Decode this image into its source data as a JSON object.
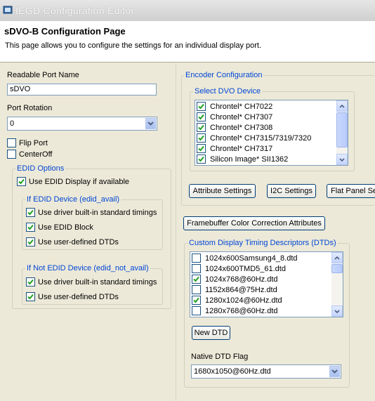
{
  "window": {
    "title": "IEGD Configuration Editor"
  },
  "header": {
    "title": "sDVO-B Configuration Page",
    "description": "This page allows you to configure the settings for an individual display port."
  },
  "left": {
    "port_name_label": "Readable Port Name",
    "port_name_value": "sDVO",
    "rotation_label": "Port Rotation",
    "rotation_value": "0",
    "flip_port": {
      "label": "Flip Port",
      "checked": false
    },
    "center_off": {
      "label": "CenterOff",
      "checked": false
    },
    "edid_options": {
      "title": "EDID Options",
      "use_edid": {
        "label": "Use EDID Display if available",
        "checked": true
      },
      "if_edid": {
        "title": "If EDID Device (edid_avail)",
        "items": [
          {
            "label": "Use driver built-in standard timings",
            "checked": true
          },
          {
            "label": "Use EDID Block",
            "checked": true
          },
          {
            "label": "Use user-defined DTDs",
            "checked": true
          }
        ]
      },
      "if_not_edid": {
        "title": "If Not EDID Device (edid_not_avail)",
        "items": [
          {
            "label": "Use driver built-in standard timings",
            "checked": true
          },
          {
            "label": "Use user-defined DTDs",
            "checked": true
          }
        ]
      }
    }
  },
  "right": {
    "encoder": {
      "title": "Encoder Configuration",
      "select_title": "Select DVO Device",
      "devices": [
        {
          "label": "Chrontel* CH7022",
          "checked": true
        },
        {
          "label": "Chrontel* CH7307",
          "checked": true
        },
        {
          "label": "Chrontel* CH7308",
          "checked": true
        },
        {
          "label": "Chrontel* CH7315/7319/7320",
          "checked": true
        },
        {
          "label": "Chrontel* CH7317",
          "checked": true
        },
        {
          "label": "Silicon Image* SII1362",
          "checked": true
        }
      ],
      "buttons": {
        "attribute": "Attribute Settings",
        "i2c": "I2C Settings",
        "flat_panel": "Flat Panel Se"
      }
    },
    "framebuffer_button": "Framebuffer Color Correction Attributes",
    "dtd": {
      "title": "Custom Display Timing Descriptors (DTDs)",
      "items": [
        {
          "label": "1024x600Samsung4_8.dtd",
          "checked": false
        },
        {
          "label": "1024x600TMD5_61.dtd",
          "checked": false
        },
        {
          "label": "1024x768@60Hz.dtd",
          "checked": true
        },
        {
          "label": "1152x864@75Hz.dtd",
          "checked": false
        },
        {
          "label": "1280x1024@60Hz.dtd",
          "checked": true
        },
        {
          "label": "1280x768@60Hz.dtd",
          "checked": false
        }
      ],
      "new_button": "New DTD",
      "native_label": "Native DTD Flag",
      "native_value": "1680x1050@60Hz.dtd"
    }
  },
  "colors": {
    "group_title": "#0046d5",
    "check": "#21a121",
    "border": "#7f9db9"
  }
}
